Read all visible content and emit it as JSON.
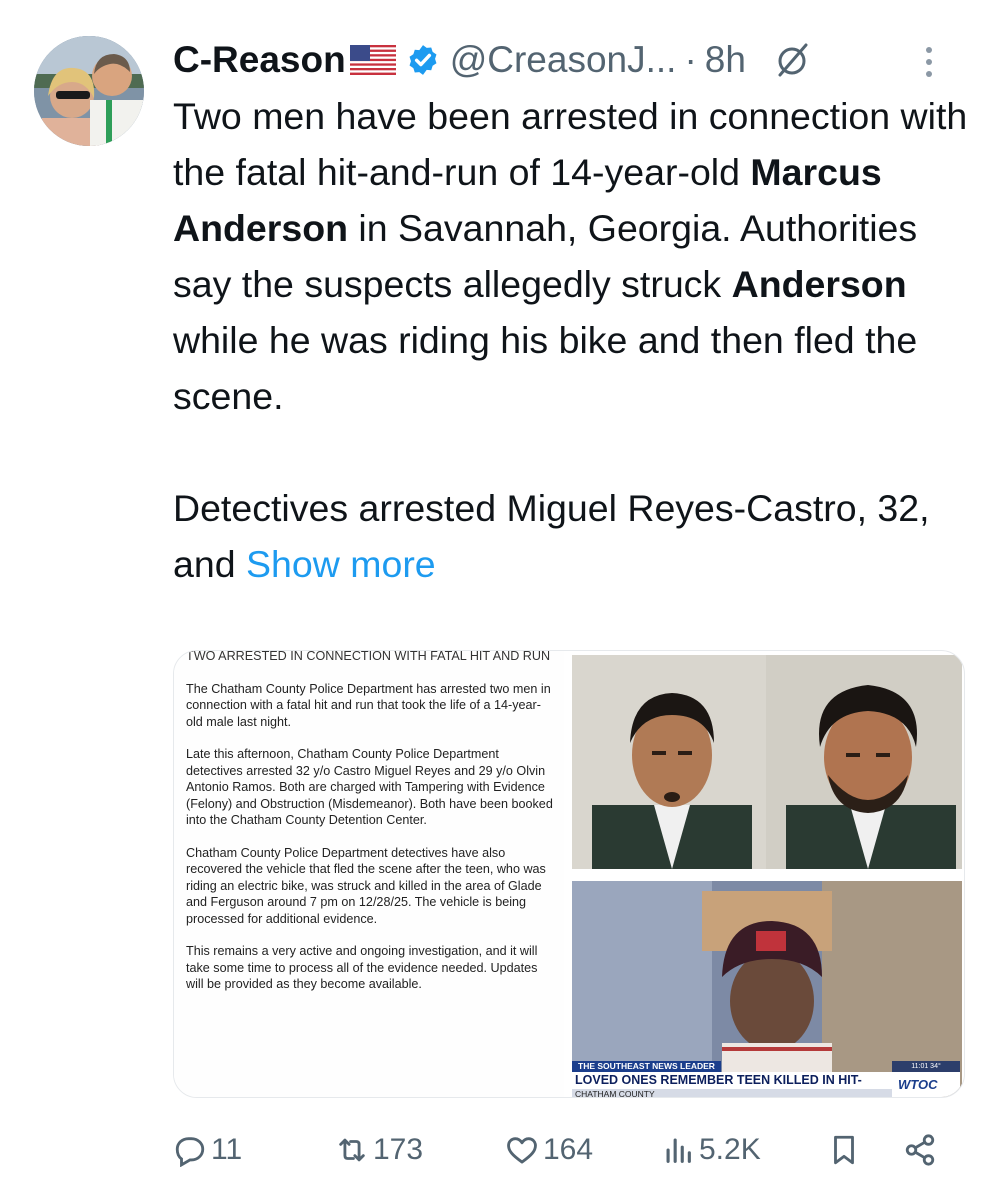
{
  "author": {
    "display_name": "C-Reason",
    "handle": "@CreasonJ...",
    "separator": "·",
    "time": "8h",
    "flag_icon": "us-flag-icon",
    "verified_icon": "verified-badge-icon",
    "grok_icon": "grok-icon",
    "more_icon": "more-options-icon"
  },
  "tweet": {
    "line1_a": "Two men have been arrested in connection with the fatal hit-and-run of 14-year-old ",
    "name_bold_1": "Marcus Anderson",
    "line1_b": " in Savannah, Georgia. Authorities say the suspects allegedly struck ",
    "name_bold_2": "Anderson",
    "line1_c": " while he was riding his bike and then fled the scene.",
    "para2": "Detectives arrested Miguel Reyes-Castro, 32, and ",
    "show_more": "Show more"
  },
  "media": {
    "doc_title": "TWO ARRESTED IN CONNECTION WITH FATAL HIT AND RUN",
    "doc_para1": "The Chatham County Police Department has arrested two men in connection with a fatal hit and run that took the life of a 14-year-old male last night.",
    "doc_para2": "Late this afternoon, Chatham County Police Department detectives arrested 32 y/o Castro Miguel Reyes and 29 y/o Olvin Antonio Ramos. Both are charged with Tampering with Evidence (Felony) and Obstruction (Misdemeanor). Both have been booked into the Chatham County Detention Center.",
    "doc_para3": "Chatham County Police Department detectives have also recovered the vehicle that fled the scene after the teen, who was riding an electric bike, was struck and killed in the area of Glade and Ferguson around 7 pm on 12/28/25. The vehicle is being processed for additional evidence.",
    "doc_para4": "This remains a very active and ongoing investigation, and it will take some time to process all of the evidence needed. Updates will be provided as they become available.",
    "news_tagline": "THE SOUTHEAST NEWS LEADER",
    "news_headline": "LOVED ONES REMEMBER TEEN KILLED IN HIT-AND-RUN",
    "news_location": "CHATHAM COUNTY",
    "news_logo": "WTOC",
    "news_time": "11:01   34°"
  },
  "actions": {
    "replies": "11",
    "reposts": "173",
    "likes": "164",
    "views": "5.2K"
  },
  "colors": {
    "text": "#0f1419",
    "muted": "#536471",
    "link": "#1d9bf0",
    "verified": "#1d9bf0"
  }
}
